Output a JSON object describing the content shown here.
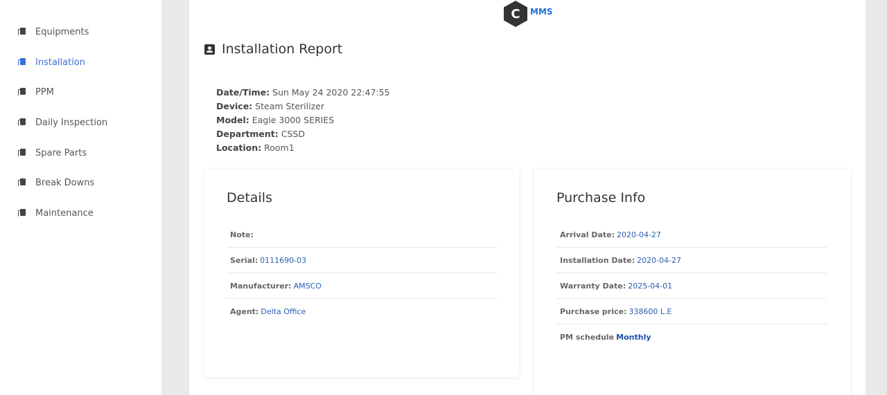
{
  "sidebar": {
    "items": [
      {
        "label": "Equipments",
        "active": false
      },
      {
        "label": "Installation",
        "active": true
      },
      {
        "label": "PPM",
        "active": false
      },
      {
        "label": "Daily Inspection",
        "active": false
      },
      {
        "label": "Spare Parts",
        "active": false
      },
      {
        "label": "Break Downs",
        "active": false
      },
      {
        "label": "Maintenance",
        "active": false
      }
    ]
  },
  "logo": {
    "letter": "C",
    "text": "MMS"
  },
  "report": {
    "title": "Installation Report",
    "meta": [
      {
        "key": "Date/Time:",
        "value": "Sun May 24 2020 22:47:55"
      },
      {
        "key": "Device:",
        "value": "Steam Sterilizer"
      },
      {
        "key": "Model:",
        "value": "Eagle 3000 SERIES"
      },
      {
        "key": "Department:",
        "value": "CSSD"
      },
      {
        "key": "Location:",
        "value": "Room1"
      }
    ]
  },
  "details": {
    "title": "Details",
    "rows": [
      {
        "key": "Note:",
        "value": ""
      },
      {
        "key": "Serial:",
        "value": "0111690-03"
      },
      {
        "key": "Manufacturer:",
        "value": "AMSCO"
      },
      {
        "key": "Agent:",
        "value": "Delta Office"
      }
    ]
  },
  "purchase": {
    "title": "Purchase Info",
    "rows": [
      {
        "key": "Arrival Date:",
        "value": "2020-04-27"
      },
      {
        "key": "Installation Date:",
        "value": "2020-04-27"
      },
      {
        "key": "Warranty Date:",
        "value": "2025-04-01"
      },
      {
        "key": "Purchase price:",
        "value": "338600 L.E"
      },
      {
        "key": "PM schedule",
        "value": "Monthly"
      }
    ]
  },
  "colors": {
    "accent": "#3a6fd8",
    "link": "#2a5db0",
    "background": "#e9e9e9",
    "logo_hex": "#333333"
  }
}
